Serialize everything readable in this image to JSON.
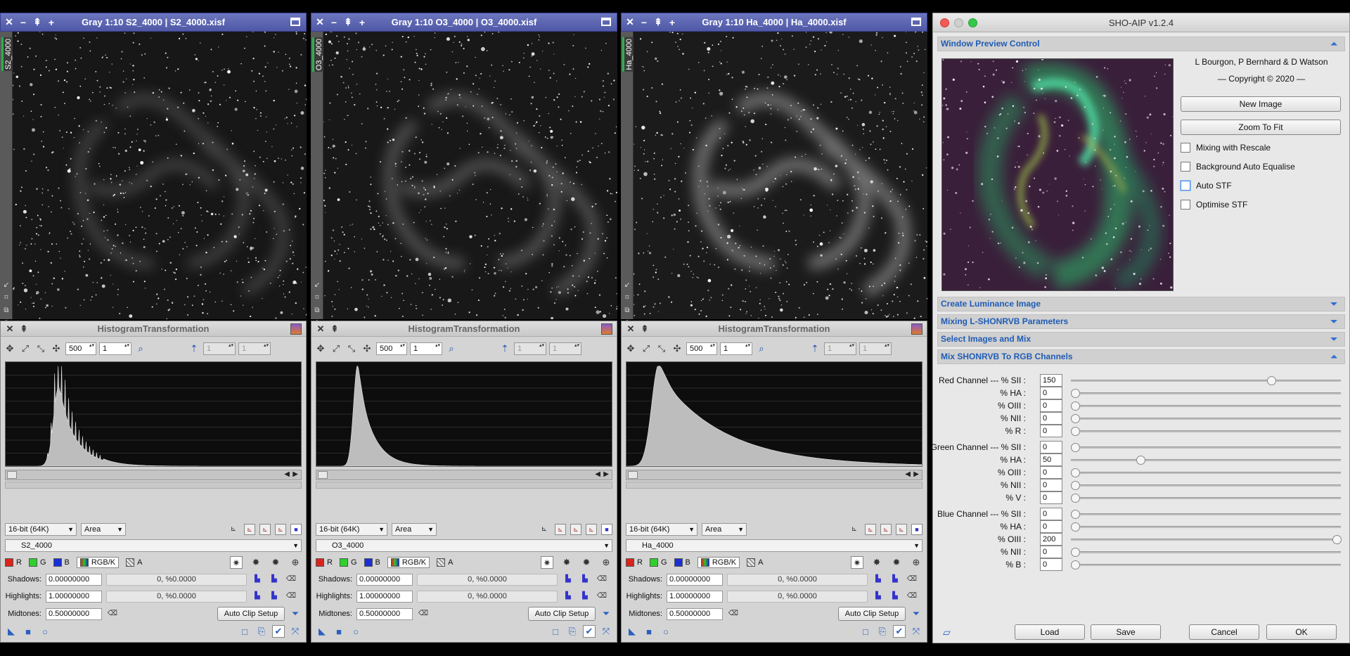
{
  "image_windows": [
    {
      "title": "Gray 1:10 S2_4000 | S2_4000.xisf",
      "id_label": "S2_4000",
      "brightness": 0.45
    },
    {
      "title": "Gray 1:10 O3_4000 | O3_4000.xisf",
      "id_label": "O3_4000",
      "brightness": 0.6
    },
    {
      "title": "Gray 1:10 Ha_4000 | Ha_4000.xisf",
      "id_label": "Ha_4000",
      "brightness": 0.85
    }
  ],
  "histograms": [
    {
      "title": "HistogramTransformation",
      "zoom_h": "500",
      "zoom_v": "1",
      "disabled_1": "1",
      "disabled_2": "1",
      "bit_depth": "16-bit (64K)",
      "mode": "Area",
      "view": "S2_4000",
      "shape": "spiky"
    },
    {
      "title": "HistogramTransformation",
      "zoom_h": "500",
      "zoom_v": "1",
      "disabled_1": "1",
      "disabled_2": "1",
      "bit_depth": "16-bit (64K)",
      "mode": "Area",
      "view": "O3_4000",
      "shape": "narrow"
    },
    {
      "title": "HistogramTransformation",
      "zoom_h": "500",
      "zoom_v": "1",
      "disabled_1": "1",
      "disabled_2": "1",
      "bit_depth": "16-bit (64K)",
      "mode": "Area",
      "view": "Ha_4000",
      "shape": "broad"
    }
  ],
  "hist_common": {
    "ch_r": "R",
    "ch_g": "G",
    "ch_b": "B",
    "ch_rgbk": "RGB/K",
    "ch_a": "A",
    "shadows_label": "Shadows:",
    "shadows_value": "0.00000000",
    "shadows_clip": "0, %0.0000",
    "highlights_label": "Highlights:",
    "highlights_value": "1.00000000",
    "highlights_clip": "0, %0.0000",
    "midtones_label": "Midtones:",
    "midtones_value": "0.50000000",
    "auto_clip": "Auto Clip Setup"
  },
  "sho": {
    "title": "SHO-AIP v1.2.4",
    "sections": {
      "window_preview": "Window Preview Control",
      "luminance": "Create Luminance Image",
      "mixing_params": "Mixing L-SHONRVB Parameters",
      "select_images": "Select Images and Mix",
      "mix_channels": "Mix SHONRVB To RGB Channels"
    },
    "authors": "L Bourgon, P Bernhard & D Watson",
    "copyright": "— Copyright © 2020 —",
    "new_image": "New Image",
    "zoom_to_fit": "Zoom To Fit",
    "checkboxes": [
      {
        "label": "Mixing with Rescale",
        "checked": false
      },
      {
        "label": "Background Auto Equalise",
        "checked": false
      },
      {
        "label": "Auto STF",
        "checked": false
      },
      {
        "label": "Optimise STF",
        "checked": false
      }
    ],
    "mix_rows": [
      {
        "label": "Red Channel --- % SII :",
        "value": "150",
        "pos": 0.75
      },
      {
        "label": "% HA :",
        "value": "0",
        "pos": 0
      },
      {
        "label": "% OIII :",
        "value": "0",
        "pos": 0
      },
      {
        "label": "% NII :",
        "value": "0",
        "pos": 0
      },
      {
        "label": "% R :",
        "value": "0",
        "pos": 0
      },
      {
        "label": "Green Channel --- % SII :",
        "value": "0",
        "pos": 0
      },
      {
        "label": "% HA :",
        "value": "50",
        "pos": 0.25
      },
      {
        "label": "% OIII :",
        "value": "0",
        "pos": 0
      },
      {
        "label": "% NII :",
        "value": "0",
        "pos": 0
      },
      {
        "label": "% V :",
        "value": "0",
        "pos": 0
      },
      {
        "label": "Blue Channel --- % SII :",
        "value": "0",
        "pos": 0
      },
      {
        "label": "% HA :",
        "value": "0",
        "pos": 0
      },
      {
        "label": "% OIII :",
        "value": "200",
        "pos": 1.0
      },
      {
        "label": "% NII :",
        "value": "0",
        "pos": 0
      },
      {
        "label": "% B :",
        "value": "0",
        "pos": 0
      }
    ],
    "load": "Load",
    "save": "Save",
    "cancel": "Cancel",
    "ok": "OK"
  }
}
